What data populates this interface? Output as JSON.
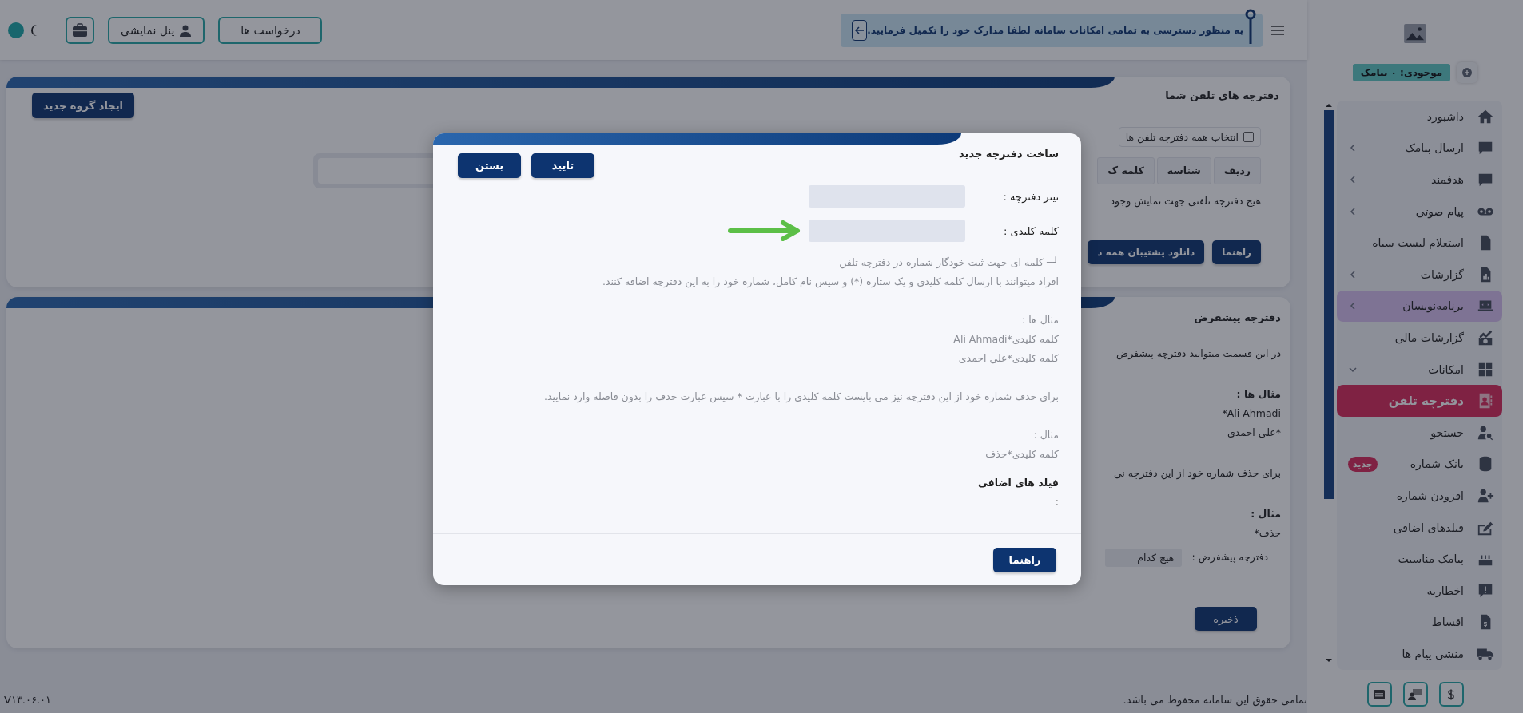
{
  "topbar": {
    "notice": "به منظور دسترسی به تمامی امکانات سامانه لطفا مدارک خود را تکمیل فرمایید.",
    "buttons": [
      "درخواست ها",
      "پنل نمایشی"
    ]
  },
  "phonebooks_card": {
    "title": "دفترچه های تلفن شما",
    "new_group_button": "ایجاد گروه جدید",
    "select_all": {
      "label": "انتخاب همه دفترچه تلفن ها",
      "checked": false
    },
    "columns": [
      "ردیف",
      "شناسه",
      "کلمه ک"
    ],
    "empty_text": "هیج دفترچه تلفنی جهت نمایش وجود",
    "buttons": [
      "راهنما",
      "دانلود پشتیبان همه د"
    ]
  },
  "default_card": {
    "title": "دفترچه پیشفرض",
    "intro": "در این قسمت میتوانید دفترچه پیشفرض",
    "examples_title": "مثال ها :",
    "examples": [
      "Ali Ahmadi*",
      "*علی احمدی"
    ],
    "delete_text": "برای حذف شماره خود از این دفترچه نی",
    "example_title": "مثال :",
    "example": "حذف*",
    "default_label": "دفترچه پیشفرض :",
    "default_value": "هیچ کدام",
    "save_button": "ذخیره"
  },
  "footer": {
    "copyright": "تمامی حقوق این سامانه محفوظ می باشد.",
    "version": "V۱۳.۰۶.۰۱"
  },
  "sidebar": {
    "credit": "موجودی: ۰ پیامک",
    "items": [
      {
        "label": "داشبورد",
        "kind": "link",
        "selected": false,
        "hovered": false
      },
      {
        "label": "ارسال پیامک",
        "kind": "group",
        "expanded": false,
        "selected": false,
        "hovered": false
      },
      {
        "label": "هدفمند",
        "kind": "group",
        "expanded": false,
        "selected": false,
        "hovered": false
      },
      {
        "label": "پیام صوتی",
        "kind": "group",
        "expanded": false,
        "selected": false,
        "hovered": false
      },
      {
        "label": "استعلام لیست سیاه",
        "kind": "link",
        "selected": false,
        "hovered": false
      },
      {
        "label": "گزارشات",
        "kind": "group",
        "expanded": false,
        "selected": false,
        "hovered": false
      },
      {
        "label": "برنامه‌نویسان",
        "kind": "group",
        "expanded": false,
        "selected": false,
        "hovered": true
      },
      {
        "label": "گزارشات مالی",
        "kind": "link",
        "selected": false,
        "hovered": false
      },
      {
        "label": "امکانات",
        "kind": "group",
        "expanded": true,
        "selected": false,
        "hovered": false
      },
      {
        "label": "دفترچه تلفن",
        "kind": "link",
        "selected": true,
        "hovered": false
      },
      {
        "label": "جستجو",
        "kind": "link",
        "selected": false,
        "hovered": false
      },
      {
        "label": "بانک شماره",
        "kind": "link",
        "selected": false,
        "hovered": false,
        "badge": "جدید"
      },
      {
        "label": "افزودن شماره",
        "kind": "link",
        "selected": false,
        "hovered": false
      },
      {
        "label": "فیلدهای اضافی",
        "kind": "link",
        "selected": false,
        "hovered": false
      },
      {
        "label": "پیامک مناسبت",
        "kind": "link",
        "selected": false,
        "hovered": false
      },
      {
        "label": "اخطاریه",
        "kind": "link",
        "selected": false,
        "hovered": false
      },
      {
        "label": "اقساط",
        "kind": "link",
        "selected": false,
        "hovered": false
      },
      {
        "label": "منشی پیام ها",
        "kind": "link",
        "selected": false,
        "hovered": false
      }
    ]
  },
  "modal": {
    "title": "ساخت دفترچه جدید",
    "buttons": [
      "تایید",
      "بستن"
    ],
    "fields": [
      {
        "label": "تیتر دفترچه :",
        "pointed": false
      },
      {
        "label": "کلمه کلیدی :",
        "pointed": true
      }
    ],
    "help": [
      [
        "┘─ کلمه ای جهت ثبت خودگار شماره در دفترچه تلفن",
        "افراد میتوانند با ارسال کلمه کلیدی و یک ستاره (*) و سپس نام کامل، شماره خود را به این دفترچه اضافه کنند."
      ],
      [
        "مثال ها :",
        "کلمه کلیدی*Ali Ahmadi",
        "کلمه کلیدی*علی احمدی"
      ],
      [
        "برای حذف شماره خود از این دفترچه نیز می بایست کلمه کلیدی را با عبارت * سپس عبارت حذف را بدون فاصله وارد نمایید."
      ],
      [
        "مثال :",
        "کلمه کلیدی*حذف"
      ]
    ],
    "extra_title": "فیلد های اضافی",
    "extra_value": ":",
    "footer_button": "راهنما"
  }
}
